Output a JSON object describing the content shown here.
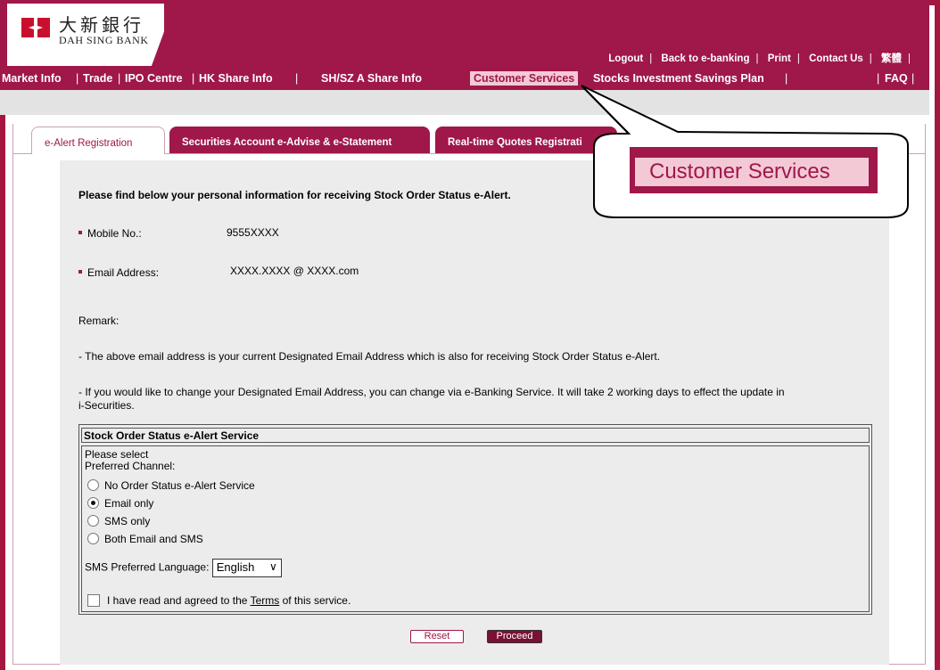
{
  "brand": {
    "name_cn": "大新銀行",
    "name_en": "DAH SING BANK"
  },
  "top_links": [
    "Logout",
    "Back to e-banking",
    "Print",
    "Contact Us",
    "繁體"
  ],
  "nav": {
    "market_info": "Market Info",
    "trade": "Trade",
    "ipo": "IPO Centre",
    "hk_share": "HK Share Info",
    "sh_share": "SH/SZ A Share Info",
    "customer_services": "Customer Services",
    "stocks_plan": "Stocks Investment Savings Plan",
    "faq": "FAQ"
  },
  "tabs": {
    "ealert": "e-Alert Registration",
    "securities": "Securities Account e-Advise & e-Statement",
    "realtime": "Real-time Quotes Registrati"
  },
  "callout_label": "Customer Services",
  "content": {
    "intro": "Please find below your personal information for receiving Stock Order Status e-Alert.",
    "mobile_label": "Mobile No.:",
    "mobile_value": "9555XXXX",
    "email_label": "Email Address:",
    "email_value": "XXXX.XXXX @ XXXX.com",
    "remark": "Remark:",
    "remark_1": "- The above email address is your current Designated Email Address which is also for receiving Stock Order Status e-Alert.",
    "remark_2a": "- If you would like to change your Designated Email Address, you can change via e-Banking Service. It will take 2 working days to effect the update in",
    "remark_2b": "i-Securities."
  },
  "service": {
    "heading": "Stock Order Status e-Alert Service",
    "please_select": "Please select",
    "preferred_channel": "Preferred Channel:",
    "options": [
      "No Order Status e-Alert Service",
      "Email only",
      "SMS only",
      "Both Email and SMS"
    ],
    "selected": "Email only",
    "sms_lang_label": "SMS Preferred Language:",
    "sms_lang_value": "English",
    "agree_prefix": "I have read and agreed to the",
    "agree_link": "Terms",
    "agree_suffix": "of this service."
  },
  "buttons": {
    "reset": "Reset",
    "proceed": "Proceed"
  },
  "colors": {
    "brand": "#a0174a",
    "panel": "#ececec",
    "highlight": "#f2c9d6"
  }
}
